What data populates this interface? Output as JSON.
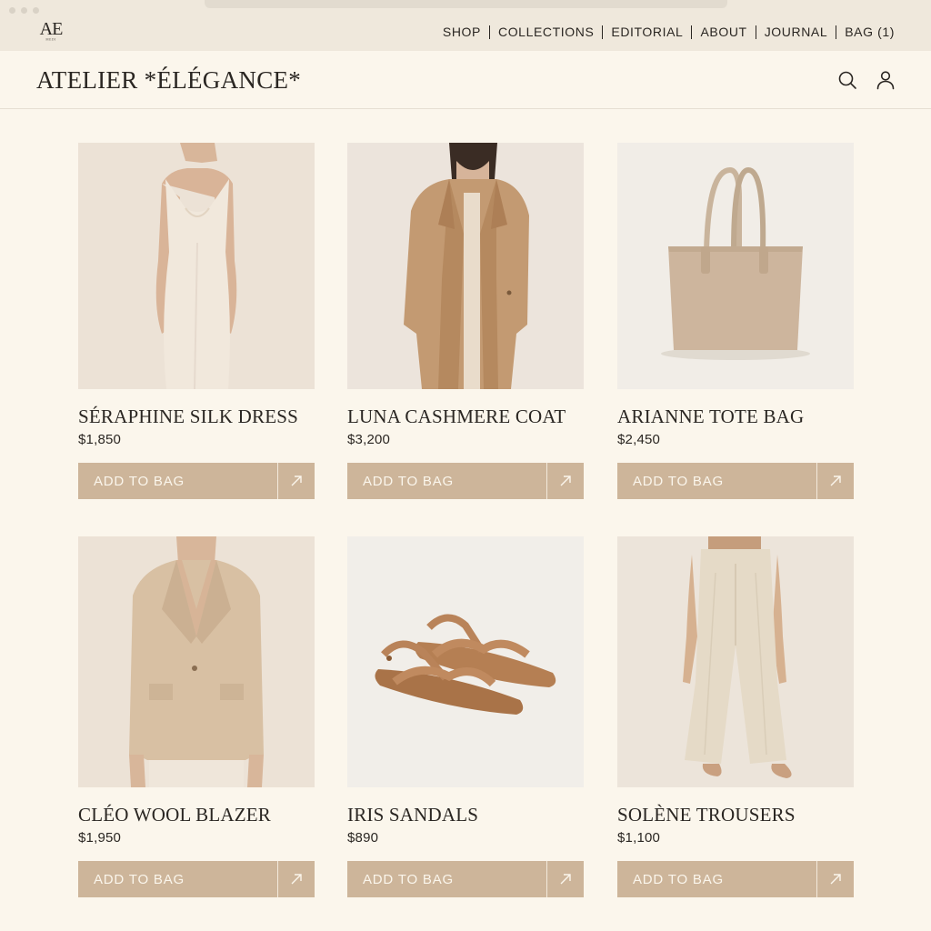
{
  "window": {
    "logo_mark": "AE",
    "logo_sub": "ᴹᴱᴰᴵ"
  },
  "topnav": {
    "items": [
      {
        "label": "SHOP"
      },
      {
        "label": "COLLECTIONS"
      },
      {
        "label": "EDITORIAL"
      },
      {
        "label": "ABOUT"
      },
      {
        "label": "JOURNAL"
      },
      {
        "label": "BAG (1)"
      }
    ]
  },
  "header": {
    "brand": "ATELIER *ÉLÉGANCE*",
    "search_icon": "search-icon",
    "account_icon": "user-icon"
  },
  "products": [
    {
      "name": "SÉRAPHINE SILK DRESS",
      "price": "$1,850",
      "cta": "ADD TO BAG",
      "image": "silk-dress"
    },
    {
      "name": "LUNA CASHMERE COAT",
      "price": "$3,200",
      "cta": "ADD TO BAG",
      "image": "cashmere-coat"
    },
    {
      "name": "ARIANNE TOTE BAG",
      "price": "$2,450",
      "cta": "ADD TO BAG",
      "image": "tote-bag"
    },
    {
      "name": "CLÉO WOOL BLAZER",
      "price": "$1,950",
      "cta": "ADD TO BAG",
      "image": "wool-blazer"
    },
    {
      "name": "IRIS SANDALS",
      "price": "$890",
      "cta": "ADD TO BAG",
      "image": "sandals"
    },
    {
      "name": "SOLÈNE TROUSERS",
      "price": "$1,100",
      "cta": "ADD TO BAG",
      "image": "trousers"
    }
  ],
  "colors": {
    "background": "#fbf6ec",
    "chrome": "#efe8dc",
    "accent_button": "#cdb59a",
    "text": "#2a2622"
  }
}
